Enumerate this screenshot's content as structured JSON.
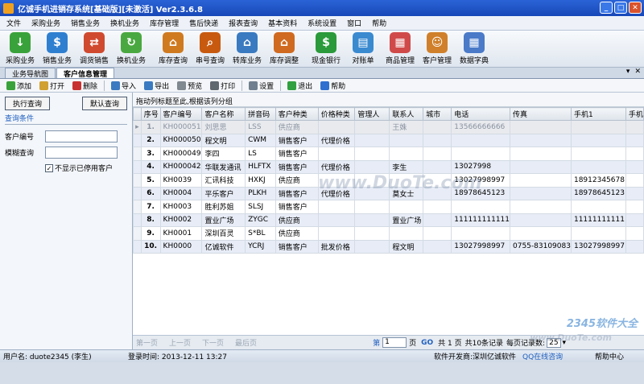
{
  "title": "亿诚手机进销存系统[基础版][未激活] Ver2.3.6.8",
  "menu": [
    "文件",
    "采购业务",
    "销售业务",
    "换机业务",
    "库存管理",
    "售后快递",
    "报表查询",
    "基本资料",
    "系统设置",
    "窗口",
    "帮助"
  ],
  "toolbar": [
    {
      "label": "采购业务",
      "color": "#3aa23a",
      "glyph": "↓"
    },
    {
      "label": "销售业务",
      "color": "#2f7fd0",
      "glyph": "$"
    },
    {
      "label": "调货销售",
      "color": "#d04a2f",
      "glyph": "⇄"
    },
    {
      "label": "换机业务",
      "color": "#4aa840",
      "glyph": "↻"
    },
    {
      "label": "库存查询",
      "color": "#d07a20",
      "glyph": "⌂"
    },
    {
      "label": "串号查询",
      "color": "#c85a10",
      "glyph": "⌕"
    },
    {
      "label": "转库业务",
      "color": "#3a7ac0",
      "glyph": "⌂"
    },
    {
      "label": "库存调整",
      "color": "#d06a20",
      "glyph": "⌂"
    },
    {
      "label": "现金银行",
      "color": "#2a9a3a",
      "glyph": "$"
    },
    {
      "label": "对账单",
      "color": "#3a8ad0",
      "glyph": "▤"
    },
    {
      "label": "商品管理",
      "color": "#d04a4a",
      "glyph": "▦"
    },
    {
      "label": "客户管理",
      "color": "#d0802a",
      "glyph": "☺"
    },
    {
      "label": "数据字典",
      "color": "#4a7ac8",
      "glyph": "▦"
    }
  ],
  "tabs": [
    "业务导航图",
    "客户信息管理"
  ],
  "subtoolbar": [
    {
      "label": "添加",
      "color": "#3aa23a"
    },
    {
      "label": "打开",
      "color": "#d0a030"
    },
    {
      "label": "删除",
      "color": "#c83030"
    },
    {
      "label": "导入",
      "color": "#3a7ac0"
    },
    {
      "label": "导出",
      "color": "#3a7ac0"
    },
    {
      "label": "预览",
      "color": "#808890"
    },
    {
      "label": "打印",
      "color": "#606870"
    },
    {
      "label": "设置",
      "color": "#708090"
    },
    {
      "label": "退出",
      "color": "#30a040"
    },
    {
      "label": "帮助",
      "color": "#2f6fd0"
    }
  ],
  "left": {
    "execute": "执行查询",
    "default_query": "默认查询",
    "conditions": "查询条件",
    "customer_no_label": "客户编号",
    "fuzzy_label": "模糊查询",
    "hide_disabled": "不显示已停用客户"
  },
  "grid": {
    "group_hint": "拖动列标题至此,根据该列分组",
    "columns": [
      "序号",
      "客户编号",
      "客户名称",
      "拼音码",
      "客户种类",
      "价格种类",
      "管理人",
      "联系人",
      "城市",
      "电话",
      "传真",
      "手机1",
      "手机"
    ],
    "rows": [
      [
        "1.",
        "KH000051",
        "刘思思",
        "LSS",
        "供应商",
        "",
        "",
        "王姝",
        "",
        "13566666666",
        "",
        "",
        ""
      ],
      [
        "2.",
        "KH000050",
        "程文明",
        "CWM",
        "销售客户",
        "代理价格",
        "",
        "",
        "",
        "",
        "",
        "",
        ""
      ],
      [
        "3.",
        "KH000049",
        "李四",
        "LS",
        "销售客户",
        "",
        "",
        "",
        "",
        "",
        "",
        "",
        ""
      ],
      [
        "4.",
        "KH000042",
        "华联发通讯",
        "HLFTX",
        "销售客户",
        "代理价格",
        "",
        "李生",
        "",
        "13027998",
        "",
        "",
        ""
      ],
      [
        "5.",
        "KH0039",
        "汇讯科技",
        "HXKJ",
        "供应商",
        "",
        "",
        "",
        "",
        "13027998997",
        "",
        "18912345678",
        ""
      ],
      [
        "6.",
        "KH0004",
        "平乐客户",
        "PLKH",
        "销售客户",
        "代理价格",
        "",
        "莫女士",
        "",
        "18978645123",
        "",
        "18978645123",
        ""
      ],
      [
        "7.",
        "KH0003",
        "胜利苏姐",
        "SLSJ",
        "销售客户",
        "",
        "",
        "",
        "",
        "",
        "",
        "",
        ""
      ],
      [
        "8.",
        "KH0002",
        "置业广场",
        "ZYGC",
        "供应商",
        "",
        "",
        "置业广场",
        "",
        "111111111111",
        "",
        "11111111111",
        ""
      ],
      [
        "9.",
        "KH0001",
        "深圳百灵",
        "S*BL",
        "供应商",
        "",
        "",
        "",
        "",
        "",
        "",
        "",
        ""
      ],
      [
        "10.",
        "KH0000",
        "亿诚软件",
        "YCRJ",
        "销售客户",
        "批发价格",
        "",
        "程文明",
        "",
        "13027998997",
        "0755-83109083",
        "13027998997",
        ""
      ]
    ]
  },
  "pager": {
    "first": "第一页",
    "prev": "上一页",
    "next": "下一页",
    "last": "最后页",
    "page_prefix": "第",
    "page_value": "1",
    "page_suffix": "页",
    "go": "GO",
    "total_pages": "共 1 页",
    "total_records": "共10条记录",
    "per_page_label": "每页记录数:",
    "per_page": "25"
  },
  "status": {
    "user": "用户名:  duote2345 (李生)",
    "login": "登录时间:  2013-12-11 13:27",
    "vendor": "软件开发商:深圳亿诚软件",
    "qq": "QQ在线咨询",
    "help": "帮助中心"
  },
  "watermarks": [
    "www.DuoTe.com",
    "2345软件大全",
    "www.DuoTe.com"
  ]
}
